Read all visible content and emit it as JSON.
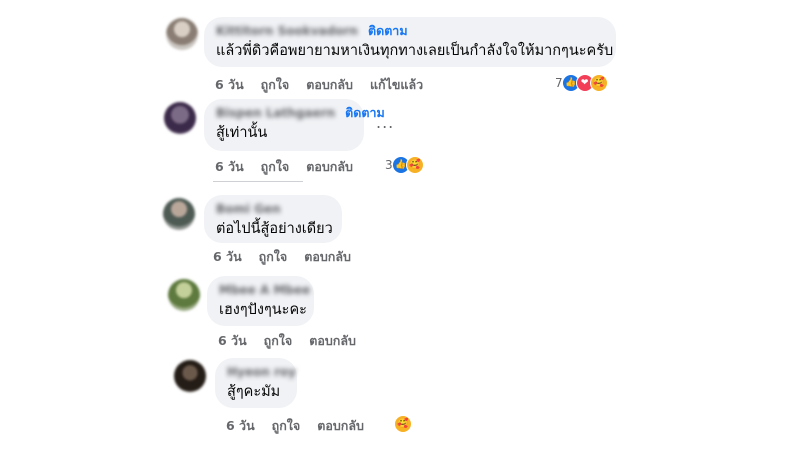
{
  "comments": [
    {
      "name": "Kittitorn Sookvadorn",
      "follow": "ติดตาม",
      "text": "แล้วพี่ดิวคือพยายามหาเงินทุกทางเลยเป็นกำลังใจให้มากๆนะครับ",
      "time": "6 วัน",
      "like": "ถูกใจ",
      "reply": "ตอบกลับ",
      "edited": "แก้ไขแล้ว",
      "reaction_count": "7",
      "reactions": [
        "like-icon",
        "love-icon",
        "care-icon"
      ]
    },
    {
      "name": "Bispen Lathgaern",
      "follow": "ติดตาม",
      "text": "สู้เท่านั้น",
      "time": "6 วัน",
      "like": "ถูกใจ",
      "reply": "ตอบกลับ",
      "more": "...",
      "reaction_count": "3",
      "reactions": [
        "like-icon",
        "care-icon"
      ]
    },
    {
      "name": "Bomi Gen",
      "text": "ต่อไปนี้สู้อย่างเดียว",
      "time": "6 วัน",
      "like": "ถูกใจ",
      "reply": "ตอบกลับ"
    },
    {
      "name": "Mbee A Mbee",
      "text": "เฮงๆปังๆนะคะ",
      "time": "6 วัน",
      "like": "ถูกใจ",
      "reply": "ตอบกลับ"
    },
    {
      "name": "Hyeon roy",
      "text": "สู้ๆคะมัม",
      "time": "6 วัน",
      "like": "ถูกใจ",
      "reply": "ตอบกลับ",
      "reactions": [
        "care-icon"
      ]
    }
  ],
  "colors": {
    "bubble": "#f0f2f5",
    "follow": "#1877f2",
    "secondary_text": "#65676b"
  }
}
